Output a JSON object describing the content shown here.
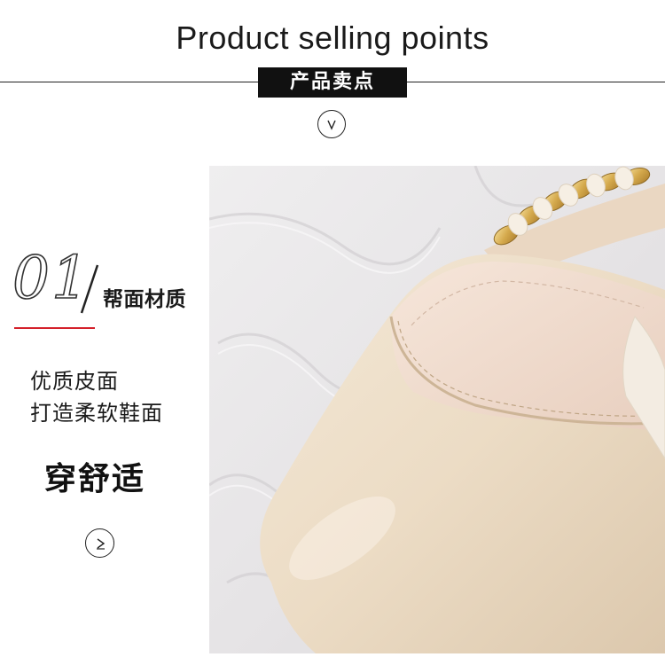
{
  "header": {
    "title": "Product selling points",
    "subtitle": "产品卖点"
  },
  "section": {
    "number": "01",
    "label": "帮面材质"
  },
  "description": {
    "line1": "优质皮面",
    "line2": "打造柔软鞋面",
    "highlight": "穿舒适"
  },
  "icons": {
    "down": "chevron-down-circle-icon",
    "next": "chevron-right-circle-icon",
    "photo": "beige-pointed-slingback-flat-shoe-photo"
  },
  "colors": {
    "accent_red": "#d4202a",
    "black": "#111111",
    "shoe_beige": "#efe1cc",
    "backdrop": "#e9e7e8"
  }
}
